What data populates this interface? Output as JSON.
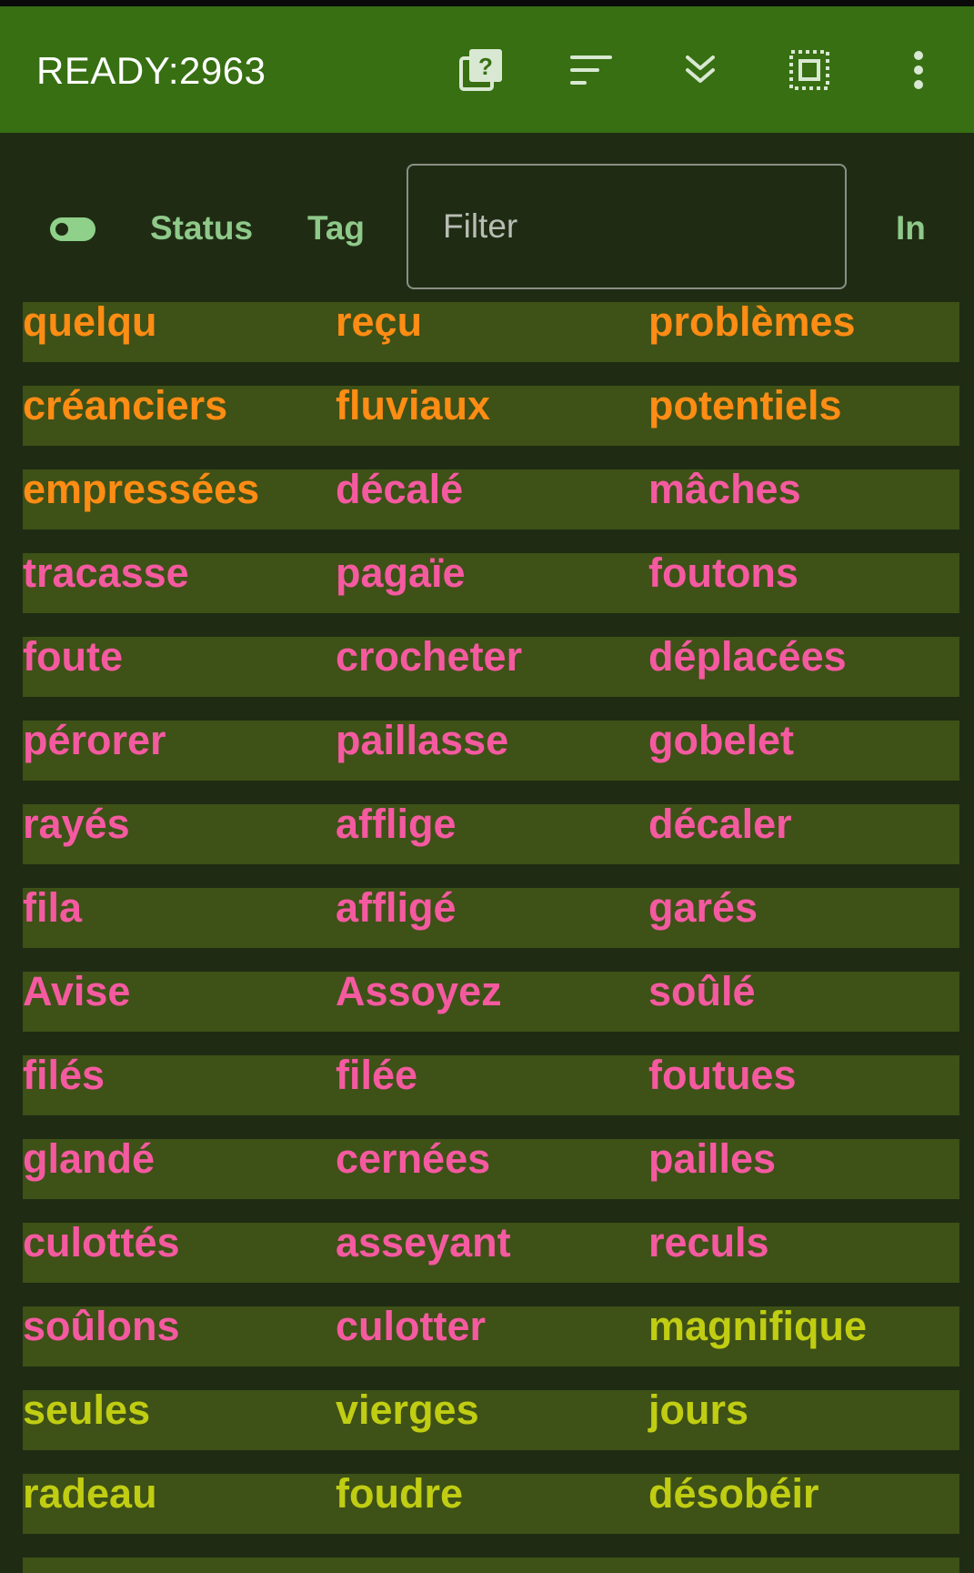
{
  "appbar": {
    "title": "READY:2963",
    "icons": [
      "help-cards-icon",
      "sort-icon",
      "expand-all-icon",
      "select-all-icon",
      "more-vert-icon"
    ]
  },
  "controls": {
    "status_label": "Status",
    "tag_label": "Tag",
    "filter_placeholder": "Filter",
    "filter_value": "",
    "in_label": "In"
  },
  "colors": {
    "appbar": "#376f12",
    "background": "#1f2c13",
    "row": "#3e5117",
    "orange": "#ff8c14",
    "pink": "#f55aa0",
    "yellow": "#c0cd12",
    "control_text": "#8fc98a"
  },
  "rows": [
    {
      "words": [
        "quelqu",
        "reçu",
        "problèmes"
      ],
      "colors": [
        "#ff8c14",
        "#ff8c14",
        "#ff8c14"
      ]
    },
    {
      "words": [
        "créanciers",
        "fluviaux",
        "potentiels"
      ],
      "colors": [
        "#ff8c14",
        "#ff8c14",
        "#ff8c14"
      ]
    },
    {
      "words": [
        "empressées",
        "décalé",
        "mâches"
      ],
      "colors": [
        "#ff8c14",
        "#f55aa0",
        "#f55aa0"
      ]
    },
    {
      "words": [
        "tracasse",
        "pagaïe",
        "foutons"
      ],
      "colors": [
        "#f55aa0",
        "#f55aa0",
        "#f55aa0"
      ]
    },
    {
      "words": [
        "foute",
        "crocheter",
        "déplacées"
      ],
      "colors": [
        "#f55aa0",
        "#f55aa0",
        "#f55aa0"
      ]
    },
    {
      "words": [
        "pérorer",
        "paillasse",
        "gobelet"
      ],
      "colors": [
        "#f55aa0",
        "#f55aa0",
        "#f55aa0"
      ]
    },
    {
      "words": [
        "rayés",
        "afflige",
        "décaler"
      ],
      "colors": [
        "#f55aa0",
        "#f55aa0",
        "#f55aa0"
      ]
    },
    {
      "words": [
        "fila",
        "affligé",
        "garés"
      ],
      "colors": [
        "#f55aa0",
        "#f55aa0",
        "#f55aa0"
      ]
    },
    {
      "words": [
        "Avise",
        "Assoyez",
        "soûlé"
      ],
      "colors": [
        "#f55aa0",
        "#f55aa0",
        "#f55aa0"
      ]
    },
    {
      "words": [
        "filés",
        "filée",
        "foutues"
      ],
      "colors": [
        "#f55aa0",
        "#f55aa0",
        "#f55aa0"
      ]
    },
    {
      "words": [
        "glandé",
        "cernées",
        "pailles"
      ],
      "colors": [
        "#f55aa0",
        "#f55aa0",
        "#f55aa0"
      ]
    },
    {
      "words": [
        "culottés",
        "asseyant",
        "reculs"
      ],
      "colors": [
        "#f55aa0",
        "#f55aa0",
        "#f55aa0"
      ]
    },
    {
      "words": [
        "soûlons",
        "culotter",
        "magnifique"
      ],
      "colors": [
        "#f55aa0",
        "#f55aa0",
        "#c0cd12"
      ]
    },
    {
      "words": [
        "seules",
        "vierges",
        "jours"
      ],
      "colors": [
        "#c0cd12",
        "#c0cd12",
        "#c0cd12"
      ]
    },
    {
      "words": [
        "radeau",
        "foudre",
        "désobéir"
      ],
      "colors": [
        "#c0cd12",
        "#c0cd12",
        "#c0cd12"
      ]
    }
  ]
}
